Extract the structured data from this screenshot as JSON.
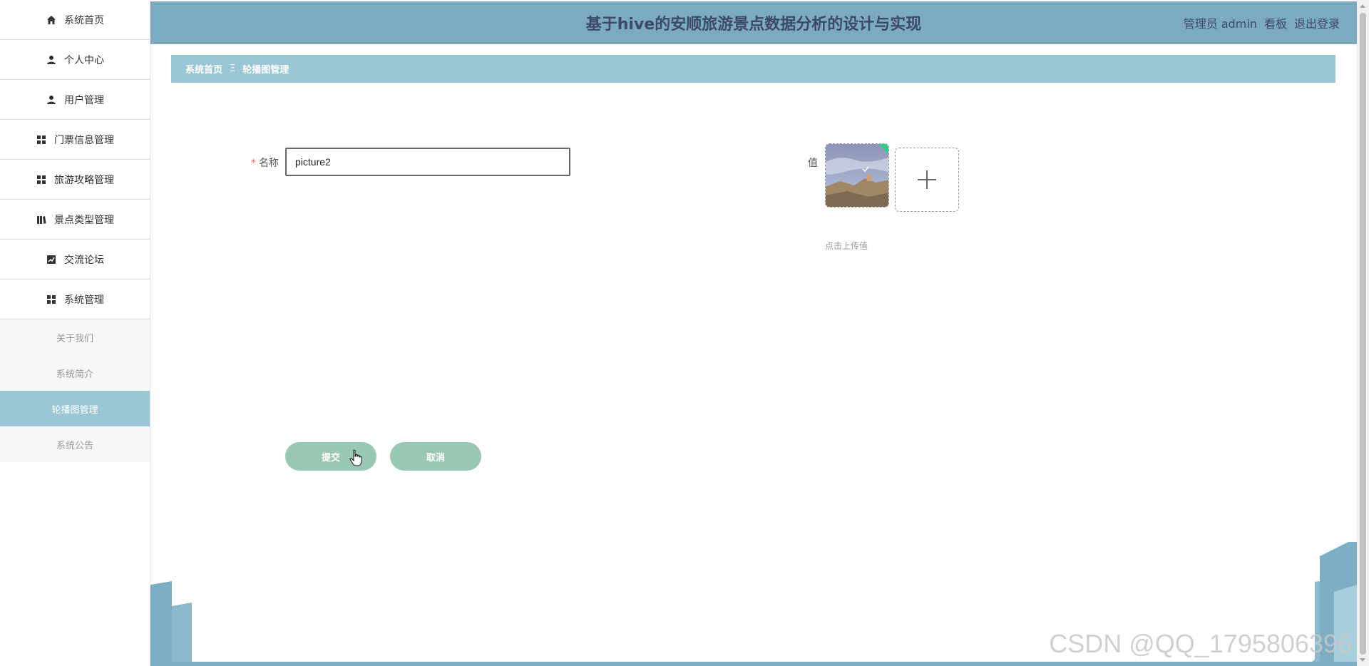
{
  "app": {
    "title": "基于hive的安顺旅游景点数据分析的设计与实现"
  },
  "header": {
    "user_label": "管理员 admin",
    "dashboard_link": "看板",
    "logout_link": "退出登录"
  },
  "sidebar": {
    "items": [
      {
        "label": "系统首页",
        "icon": "home-icon"
      },
      {
        "label": "个人中心",
        "icon": "user-icon"
      },
      {
        "label": "用户管理",
        "icon": "user-icon"
      },
      {
        "label": "门票信息管理",
        "icon": "grid-icon"
      },
      {
        "label": "旅游攻略管理",
        "icon": "grid-icon"
      },
      {
        "label": "景点类型管理",
        "icon": "book-icon"
      },
      {
        "label": "交流论坛",
        "icon": "chart-icon"
      },
      {
        "label": "系统管理",
        "icon": "grid-icon"
      }
    ],
    "sub_items": [
      {
        "label": "关于我们",
        "active": false
      },
      {
        "label": "系统简介",
        "active": false
      },
      {
        "label": "轮播图管理",
        "active": true
      },
      {
        "label": "系统公告",
        "active": false
      }
    ]
  },
  "breadcrumb": {
    "home": "系统首页",
    "separator": "Ξ",
    "current": "轮播图管理"
  },
  "form": {
    "name_label": "名称",
    "name_required_mark": "*",
    "name_value": "picture2",
    "value_label": "值",
    "upload_hint": "点击上传值",
    "submit_label": "提交",
    "cancel_label": "取消"
  },
  "watermark": "CSDN @QQ_1795806396",
  "colors": {
    "header_bg": "#7baac1",
    "breadcrumb_bg": "#9ac6d5",
    "active_menu_bg": "#9ac6d5",
    "button_bg": "#99c8b5",
    "title_color": "#3d4a66"
  }
}
